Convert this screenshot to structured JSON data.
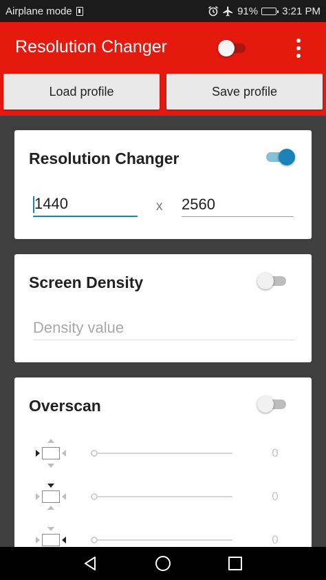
{
  "status_bar": {
    "network_label": "Airplane mode",
    "battery": "91%",
    "time": "3:21 PM",
    "icons": [
      "sim-card-icon",
      "alarm-clock-icon",
      "airplane-icon",
      "battery-icon"
    ]
  },
  "app_bar": {
    "title": "Resolution Changer",
    "master_switch_on": false,
    "menu_icon": "more-vert-icon",
    "color": "#e6190f"
  },
  "profile_buttons": {
    "load_label": "Load profile",
    "save_label": "Save profile"
  },
  "resolution_card": {
    "title": "Resolution Changer",
    "enabled": true,
    "width": "1440",
    "separator": "x",
    "height": "2560"
  },
  "density_card": {
    "title": "Screen Density",
    "enabled": false,
    "placeholder": "Density value"
  },
  "overscan_card": {
    "title": "Overscan",
    "enabled": false,
    "rows": [
      {
        "side": "left",
        "value": "0"
      },
      {
        "side": "top",
        "value": "0"
      },
      {
        "side": "right",
        "value": "0"
      }
    ]
  },
  "nav_bar": {
    "icons": [
      "back-icon",
      "home-icon",
      "recents-icon"
    ]
  },
  "colors": {
    "accent": "#1a82b4",
    "app_bar": "#e6190f",
    "background": "#3f3f3f"
  }
}
